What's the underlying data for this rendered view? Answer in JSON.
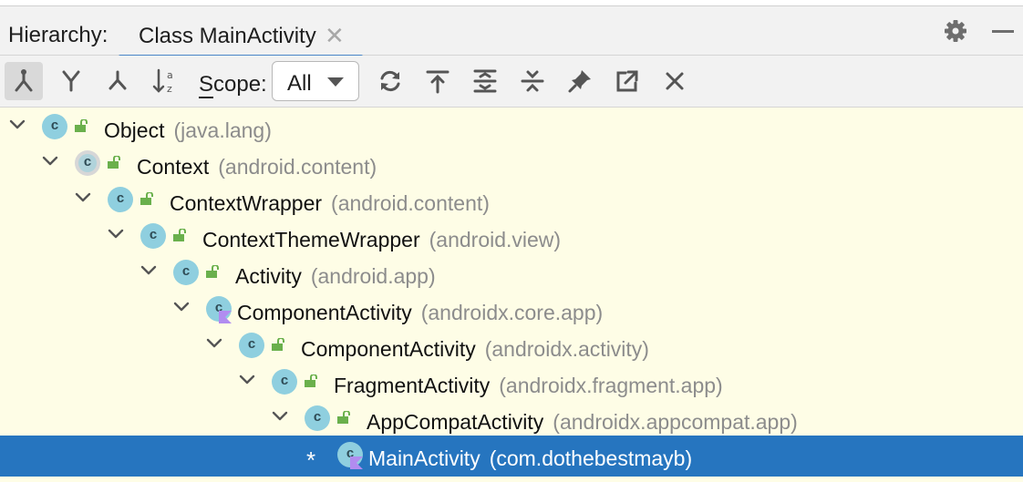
{
  "header": {
    "title_label": "Hierarchy:",
    "tab_label": "Class MainActivity",
    "tab_close_glyph": "✕",
    "settings_icon": "gear-icon",
    "minimize_icon": "minimize-icon"
  },
  "toolbar": {
    "buttons": [
      {
        "name": "type-hierarchy-icon",
        "active": true
      },
      {
        "name": "supertypes-hierarchy-icon",
        "active": false
      },
      {
        "name": "subtypes-hierarchy-icon",
        "active": false
      },
      {
        "name": "sort-alphabetically-icon",
        "active": false
      }
    ],
    "scope_label": "Scope:",
    "scope_mnemonic": "S",
    "scope_label_rest": "cope:",
    "scope_value": "All",
    "actions": [
      {
        "name": "refresh-icon"
      },
      {
        "name": "scroll-to-source-icon"
      },
      {
        "name": "expand-all-icon"
      },
      {
        "name": "collapse-all-icon"
      },
      {
        "name": "pin-icon"
      },
      {
        "name": "open-in-window-icon"
      },
      {
        "name": "close-icon"
      }
    ]
  },
  "tree": {
    "nodes": [
      {
        "name": "Object",
        "package": "(java.lang)",
        "depth": 0,
        "icon": "class",
        "lock": true,
        "expanded": true
      },
      {
        "name": "Context",
        "package": "(android.content)",
        "depth": 1,
        "icon": "abstract-class",
        "lock": true,
        "expanded": true
      },
      {
        "name": "ContextWrapper",
        "package": "(android.content)",
        "depth": 2,
        "icon": "class",
        "lock": true,
        "expanded": true
      },
      {
        "name": "ContextThemeWrapper",
        "package": "(android.view)",
        "depth": 3,
        "icon": "class",
        "lock": true,
        "expanded": true
      },
      {
        "name": "Activity",
        "package": "(android.app)",
        "depth": 4,
        "icon": "class",
        "lock": true,
        "expanded": true
      },
      {
        "name": "ComponentActivity",
        "package": "(androidx.core.app)",
        "depth": 5,
        "icon": "kotlin-class",
        "lock": false,
        "expanded": true
      },
      {
        "name": "ComponentActivity",
        "package": "(androidx.activity)",
        "depth": 6,
        "icon": "class",
        "lock": true,
        "expanded": true
      },
      {
        "name": "FragmentActivity",
        "package": "(androidx.fragment.app)",
        "depth": 7,
        "icon": "class",
        "lock": true,
        "expanded": true
      },
      {
        "name": "AppCompatActivity",
        "package": "(androidx.appcompat.app)",
        "depth": 8,
        "icon": "class",
        "lock": true,
        "expanded": true
      },
      {
        "name": "MainActivity",
        "package": "(com.dothebestmayb)",
        "depth": 9,
        "icon": "kotlin-class",
        "lock": false,
        "expanded": false,
        "marker": "*",
        "selected": true
      }
    ]
  },
  "colors": {
    "tree_background": "#fefde6",
    "selection": "#2675bf",
    "class_icon": "#8fcfdf",
    "lock_green": "#6ab04c",
    "kotlin_purple": "#b18cf0",
    "tab_underline": "#4a86c8"
  }
}
